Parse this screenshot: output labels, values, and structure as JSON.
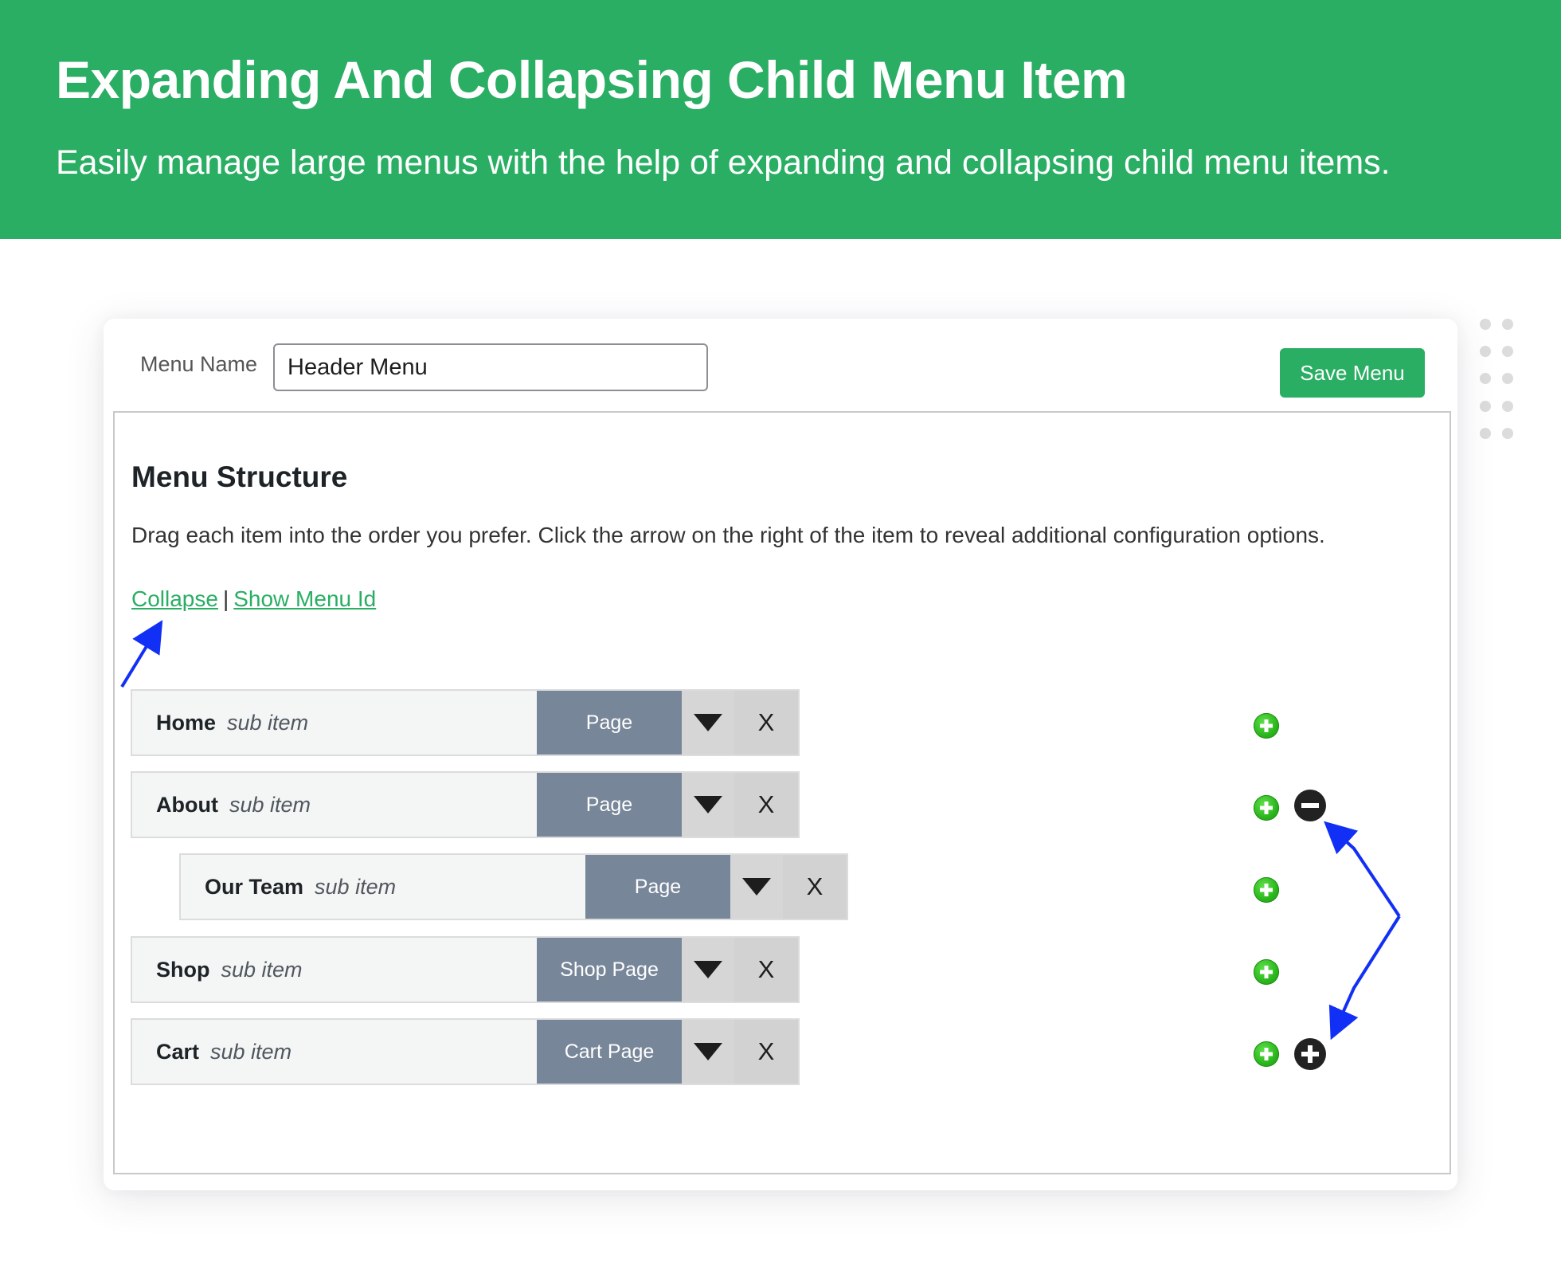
{
  "banner": {
    "title": "Expanding And Collapsing Child Menu Item",
    "subtitle": "Easily manage large menus with the help of expanding and collapsing child menu items."
  },
  "menu_name": {
    "label": "Menu Name",
    "value": "Header Menu"
  },
  "save_button": "Save Menu",
  "structure": {
    "title": "Menu Structure",
    "description": "Drag each item into the order you prefer. Click the arrow on the right of the item to reveal additional configuration options.",
    "collapse_link": "Collapse",
    "separator": "|",
    "show_id_link": "Show Menu Id"
  },
  "items": [
    {
      "name": "Home",
      "sub": "sub item",
      "type": "Page",
      "remove": "X",
      "child_control": "none"
    },
    {
      "name": "About",
      "sub": "sub item",
      "type": "Page",
      "remove": "X",
      "child_control": "collapse"
    },
    {
      "name": "Our Team",
      "sub": "sub item",
      "type": "Page",
      "remove": "X",
      "child_control": "none",
      "indent": 1
    },
    {
      "name": "Shop",
      "sub": "sub item",
      "type": "Shop Page",
      "remove": "X",
      "child_control": "none"
    },
    {
      "name": "Cart",
      "sub": "sub item",
      "type": "Cart Page",
      "remove": "X",
      "child_control": "expand"
    }
  ],
  "colors": {
    "brand_green": "#29ae63",
    "item_type_bg": "#778699",
    "annotation_arrow": "#1230f5"
  },
  "icons": {
    "add_child": "green-plus-icon",
    "collapse": "minus-circle-icon",
    "expand": "plus-circle-icon",
    "toggle": "caret-down-icon"
  }
}
